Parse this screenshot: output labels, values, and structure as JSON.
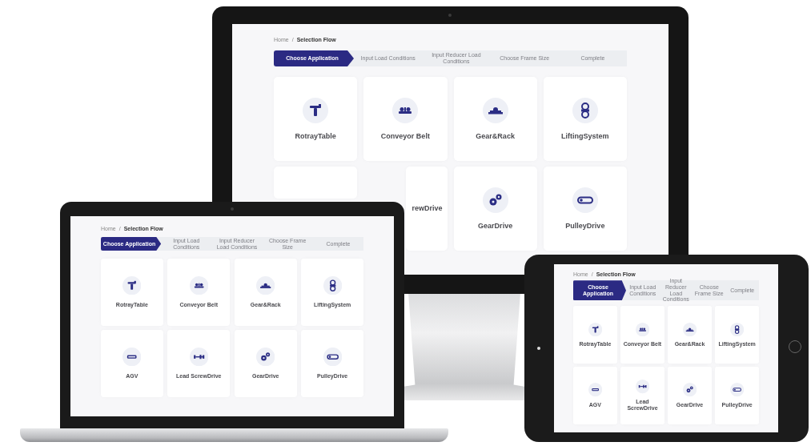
{
  "devices": [
    {
      "kind": "monitor",
      "breadcrumb": {
        "items": [
          "Home",
          "Selection Flow"
        ],
        "separator": "/"
      },
      "steps": [
        {
          "label": "Choose Application",
          "selected": true
        },
        {
          "label": "Input Load Conditions",
          "selected": false
        },
        {
          "label": "Input Reducer Load Conditions",
          "selected": false
        },
        {
          "label": "Choose Frame Size",
          "selected": false
        },
        {
          "label": "Complete",
          "selected": false
        }
      ],
      "cards": [
        {
          "label": "RotrayTable",
          "kind": "table"
        },
        {
          "label": "Conveyor Belt",
          "kind": "conveyor"
        },
        {
          "label": "Gear&Rack",
          "kind": "rack"
        },
        {
          "label": "LiftingSystem",
          "kind": "lift"
        },
        {
          "clipped": true
        },
        {
          "label": "rewDrive",
          "clipped": true
        },
        {
          "label": "GearDrive",
          "kind": "gears"
        },
        {
          "label": "PulleyDrive",
          "kind": "belt"
        }
      ]
    },
    {
      "kind": "laptop",
      "breadcrumb": {
        "items": [
          "Home",
          "Selection Flow"
        ],
        "separator": "/"
      },
      "steps": [
        {
          "label": "Choose Application",
          "selected": true
        },
        {
          "label": "Input Load Conditions",
          "selected": false
        },
        {
          "label": "Input Reducer Load Conditions",
          "selected": false
        },
        {
          "label": "Choose Frame Size",
          "selected": false
        },
        {
          "label": "Complete",
          "selected": false
        }
      ],
      "cards": [
        {
          "label": "RotrayTable",
          "kind": "table"
        },
        {
          "label": "Conveyor Belt",
          "kind": "conveyor"
        },
        {
          "label": "Gear&Rack",
          "kind": "rack"
        },
        {
          "label": "LiftingSystem",
          "kind": "lift"
        },
        {
          "label": "AGV",
          "kind": "vehicle"
        },
        {
          "label": "Lead ScrewDrive",
          "kind": "screw"
        },
        {
          "label": "GearDrive",
          "kind": "gears"
        },
        {
          "label": "PulleyDrive",
          "kind": "belt"
        }
      ]
    },
    {
      "kind": "tablet",
      "breadcrumb": {
        "items": [
          "Home",
          "Selection Flow"
        ],
        "separator": "/"
      },
      "steps": [
        {
          "label": "Choose Application",
          "selected": true
        },
        {
          "label": "Input Load Conditions",
          "selected": false
        },
        {
          "label": "Input Reducer Load Conditions",
          "selected": false
        },
        {
          "label": "Choose Frame Size",
          "selected": false
        },
        {
          "label": "Complete",
          "selected": false
        }
      ],
      "cards": [
        {
          "label": "RotrayTable",
          "kind": "table"
        },
        {
          "label": "Conveyor Belt",
          "kind": "conveyor"
        },
        {
          "label": "Gear&Rack",
          "kind": "rack"
        },
        {
          "label": "LiftingSystem",
          "kind": "lift"
        },
        {
          "label": "AGV",
          "kind": "vehicle"
        },
        {
          "label": "Lead ScrewDrive",
          "kind": "screw"
        },
        {
          "label": "GearDrive",
          "kind": "gears"
        },
        {
          "label": "PulleyDrive",
          "kind": "belt"
        }
      ]
    }
  ]
}
